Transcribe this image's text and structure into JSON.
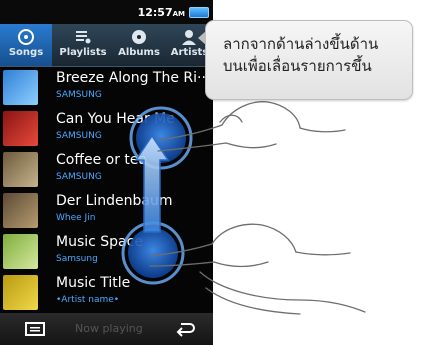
{
  "status": {
    "time": "12:57",
    "ampm": "AM"
  },
  "tabs": [
    {
      "label": "Songs",
      "icon": "disc-icon",
      "active": true
    },
    {
      "label": "Playlists",
      "icon": "playlist-icon",
      "active": false
    },
    {
      "label": "Albums",
      "icon": "album-icon",
      "active": false
    },
    {
      "label": "Artists",
      "icon": "artist-icon",
      "active": false
    }
  ],
  "songs": [
    {
      "title": "Breeze Along The Ri···",
      "artist": "SAMSUNG"
    },
    {
      "title": "Can You Hear Me",
      "artist": "SAMSUNG"
    },
    {
      "title": "Coffee or tea",
      "artist": "SAMSUNG"
    },
    {
      "title": "Der Lindenbaum",
      "artist": "Whee Jin"
    },
    {
      "title": "Music Space",
      "artist": "Samsung"
    },
    {
      "title": "Music Title",
      "artist": "•Artist name•"
    }
  ],
  "bottom": {
    "now_playing": "Now playing"
  },
  "callout": {
    "line1": "ลากจากด้านล่างขึ้นด้าน",
    "line2": "บนเพื่อเลื่อนรายการขึ้น"
  },
  "colors": {
    "accent": "#2a7bd0",
    "artist_text": "#4aa8ff",
    "touch": "#1e63c8"
  }
}
